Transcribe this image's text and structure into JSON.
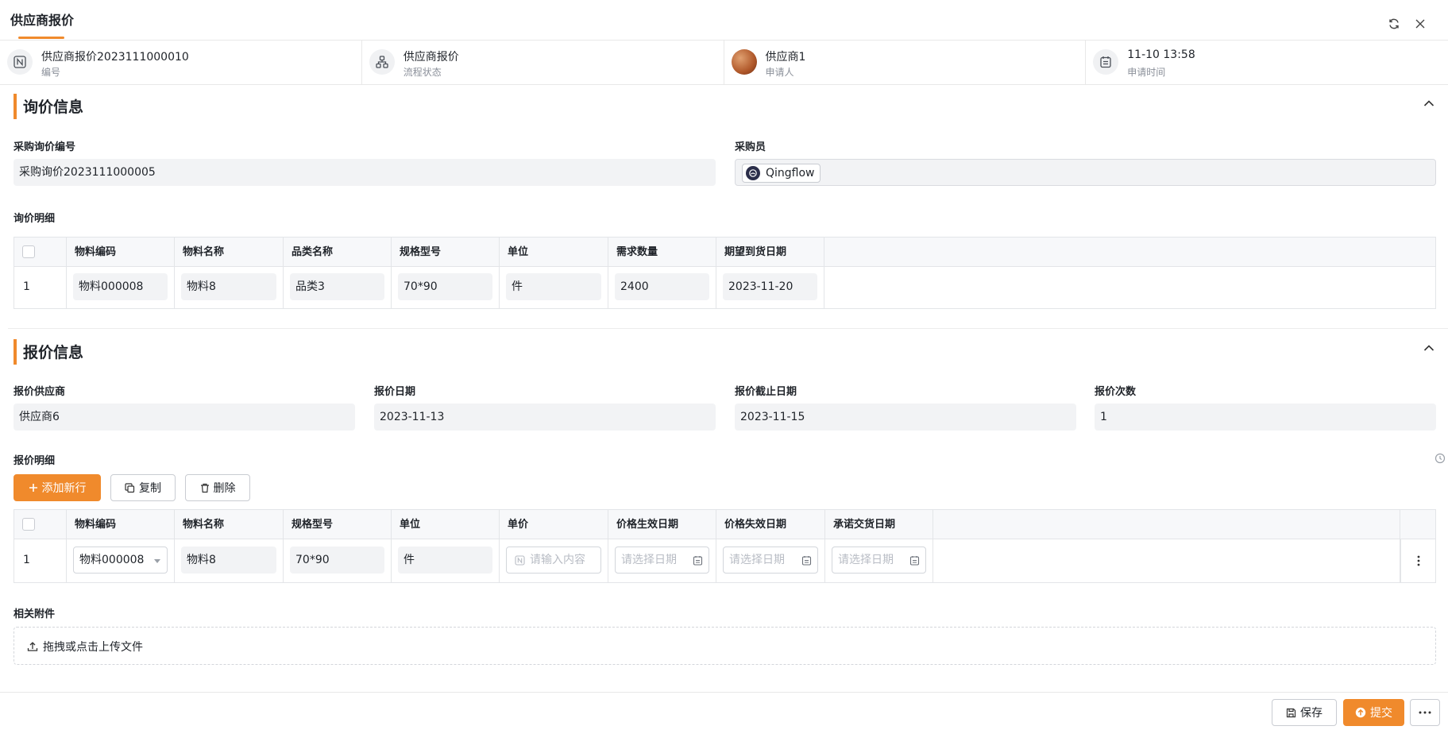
{
  "tab": {
    "title": "供应商报价"
  },
  "meta": [
    {
      "value": "供应商报价2023111000010",
      "label": "编号",
      "icon": "id-icon"
    },
    {
      "value": "供应商报价",
      "label": "流程状态",
      "icon": "workflow-icon"
    },
    {
      "value": "供应商1",
      "label": "申请人",
      "icon": "avatar"
    },
    {
      "value": "11-10 13:58",
      "label": "申请时间",
      "icon": "calendar-icon"
    }
  ],
  "inquiry": {
    "title": "询价信息",
    "code_label": "采购询价编号",
    "code_value": "采购询价2023111000005",
    "buyer_label": "采购员",
    "buyer_value": "Qingflow",
    "detail_label": "询价明细",
    "columns": [
      "物料编码",
      "物料名称",
      "品类名称",
      "规格型号",
      "单位",
      "需求数量",
      "期望到货日期"
    ],
    "rows": [
      {
        "no": "1",
        "cells": [
          "物料000008",
          "物料8",
          "品类3",
          "70*90",
          "件",
          "2400",
          "2023-11-20"
        ]
      }
    ]
  },
  "quote": {
    "title": "报价信息",
    "supplier_label": "报价供应商",
    "supplier_value": "供应商6",
    "date_label": "报价日期",
    "date_value": "2023-11-13",
    "deadline_label": "报价截止日期",
    "deadline_value": "2023-11-15",
    "count_label": "报价次数",
    "count_value": "1",
    "detail_label": "报价明细",
    "add_row_label": "添加新行",
    "copy_label": "复制",
    "delete_label": "删除",
    "columns": [
      "物料编码",
      "物料名称",
      "规格型号",
      "单位",
      "单价",
      "价格生效日期",
      "价格失效日期",
      "承诺交货日期"
    ],
    "rows": [
      {
        "no": "1",
        "material_code": "物料000008",
        "material_name": "物料8",
        "spec": "70*90",
        "unit": "件",
        "price_placeholder": "请输入内容",
        "effective_placeholder": "请选择日期",
        "expire_placeholder": "请选择日期",
        "delivery_placeholder": "请选择日期"
      }
    ]
  },
  "attachments": {
    "label": "相关附件",
    "upload_text": "拖拽或点击上传文件"
  },
  "footer": {
    "save_label": "保存",
    "submit_label": "提交"
  },
  "colors": {
    "accent": "#f08a2c",
    "fill": "#f2f3f5",
    "border": "#e3e5e8"
  }
}
